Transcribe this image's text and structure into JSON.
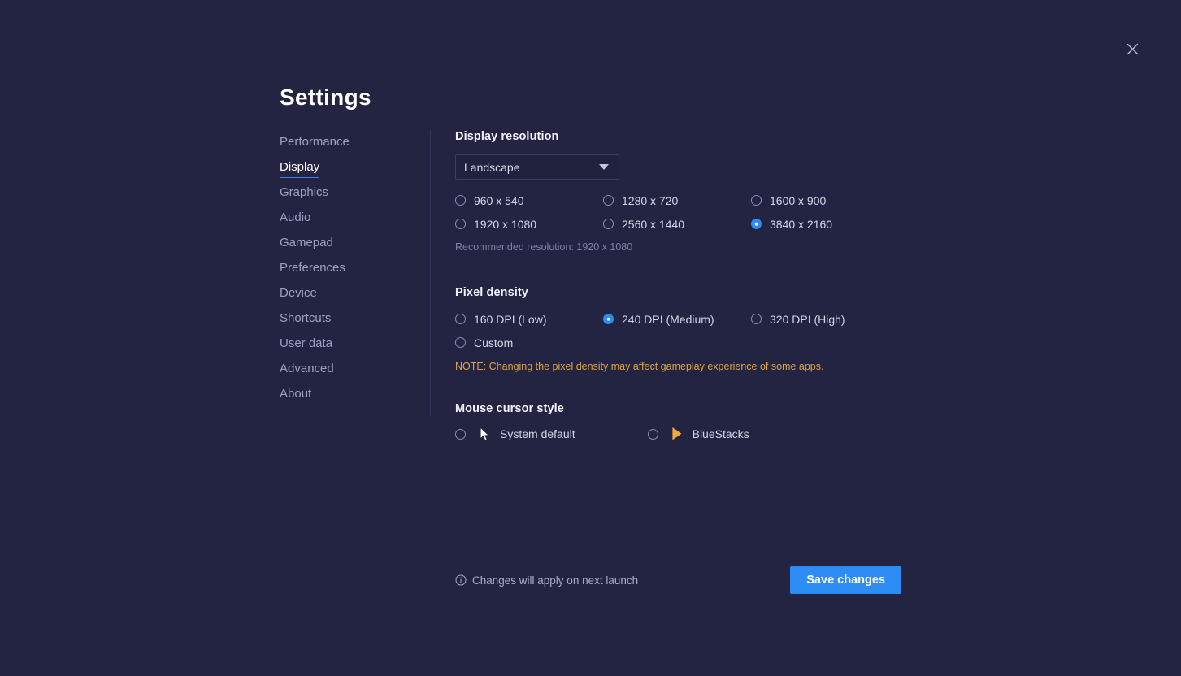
{
  "window": {
    "title": "Settings",
    "close_icon": "close-icon"
  },
  "sidebar": {
    "items": [
      {
        "label": "Performance",
        "active": false
      },
      {
        "label": "Display",
        "active": true
      },
      {
        "label": "Graphics",
        "active": false
      },
      {
        "label": "Audio",
        "active": false
      },
      {
        "label": "Gamepad",
        "active": false
      },
      {
        "label": "Preferences",
        "active": false
      },
      {
        "label": "Device",
        "active": false
      },
      {
        "label": "Shortcuts",
        "active": false
      },
      {
        "label": "User data",
        "active": false
      },
      {
        "label": "Advanced",
        "active": false
      },
      {
        "label": "About",
        "active": false
      }
    ]
  },
  "display_resolution": {
    "heading": "Display resolution",
    "orientation_dropdown": {
      "selected": "Landscape",
      "caret_icon": "chevron-down-icon"
    },
    "options": [
      {
        "label": "960 x 540",
        "selected": false
      },
      {
        "label": "1280 x 720",
        "selected": false
      },
      {
        "label": "1600 x 900",
        "selected": false
      },
      {
        "label": "1920 x 1080",
        "selected": false
      },
      {
        "label": "2560 x 1440",
        "selected": false
      },
      {
        "label": "3840 x 2160",
        "selected": true
      }
    ],
    "recommendation": "Recommended resolution: 1920 x 1080"
  },
  "pixel_density": {
    "heading": "Pixel density",
    "options": [
      {
        "label": "160 DPI (Low)",
        "selected": false
      },
      {
        "label": "240 DPI (Medium)",
        "selected": true
      },
      {
        "label": "320 DPI (High)",
        "selected": false
      },
      {
        "label": "Custom",
        "selected": false
      }
    ],
    "note": "NOTE: Changing the pixel density may affect gameplay experience of some apps."
  },
  "mouse_cursor_style": {
    "heading": "Mouse cursor style",
    "options": [
      {
        "label": "System default",
        "selected": false,
        "icon": "system-cursor-icon"
      },
      {
        "label": "BlueStacks",
        "selected": true,
        "icon": "bluestacks-cursor-icon"
      }
    ]
  },
  "footer": {
    "info_icon": "info-icon",
    "apply_text": "Changes will apply on next launch",
    "save_label": "Save changes"
  },
  "colors": {
    "background": "#232442",
    "accent_blue": "#2e8df5",
    "note_orange": "#e0a33f",
    "cursor_orange": "#f0a93c",
    "text_primary": "#e8e9f5",
    "text_muted": "#9ea2c2"
  }
}
